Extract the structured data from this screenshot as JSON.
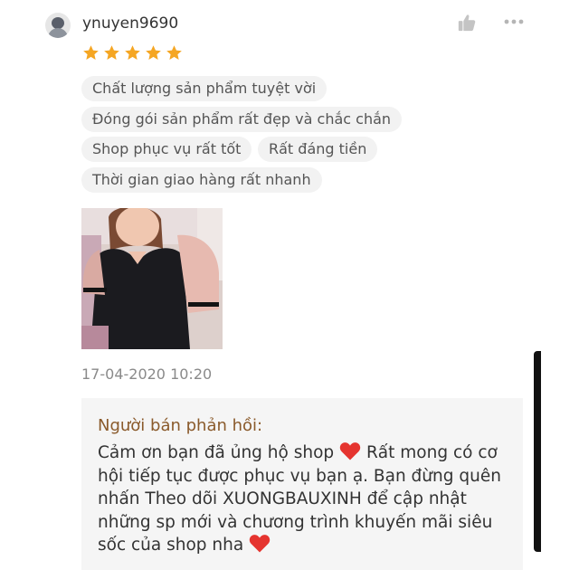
{
  "review": {
    "username": "ynuyen9690",
    "rating": 5,
    "star_color": "#f5a623",
    "tags": [
      "Chất lượng sản phẩm tuyệt vời",
      "Đóng gói sản phẩm rất đẹp và chắc chắn",
      "Shop phục vụ rất tốt",
      "Rất đáng tiền",
      "Thời gian giao hàng rất nhanh"
    ],
    "timestamp": "17-04-2020 10:20",
    "icons": {
      "avatar": "user-avatar",
      "like": "thumbs-up-icon",
      "more": "more-options-icon",
      "star": "star-icon"
    }
  },
  "seller_reply": {
    "title": "Người bán phản hồi:",
    "line1": "Cảm ơn bạn đã ủng hộ shop",
    "line2": "Rất mong có cơ hội tiếp tục được phục vụ bạn ạ. Bạn đừng quên nhấn Theo dõi XUONGBAUXINH để cập nhật những sp mới và chương trình khuyến mãi siêu sốc của shop nha",
    "heart_color": "#e5342f"
  }
}
